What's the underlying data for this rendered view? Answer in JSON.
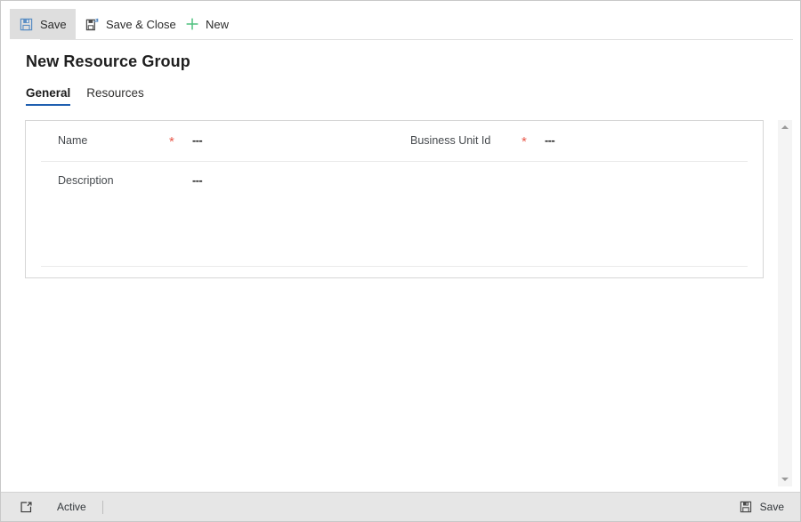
{
  "command_bar": {
    "buttons": [
      {
        "label": "Save",
        "icon": "floppy-disk-icon",
        "active": true
      },
      {
        "label": "Save & Close",
        "icon": "save-and-close-icon",
        "active": false
      },
      {
        "label": "New",
        "icon": "plus-icon",
        "active": false
      }
    ]
  },
  "page": {
    "title": "New Resource Group"
  },
  "tabs": [
    {
      "label": "General",
      "selected": true
    },
    {
      "label": "Resources",
      "selected": false
    }
  ],
  "form": {
    "fields": [
      {
        "label": "Name",
        "required": true,
        "required_mark": "*",
        "value": "---"
      },
      {
        "label": "Business Unit Id",
        "required": true,
        "required_mark": "*",
        "value": "---"
      },
      {
        "label": "Description",
        "required": false,
        "required_mark": "",
        "value": "---"
      }
    ]
  },
  "status_bar": {
    "popout_icon": "open-in-new-window-icon",
    "state": "Active",
    "save_label": "Save",
    "save_icon": "floppy-disk-icon"
  },
  "scrollbar": {
    "up_arrow_icon": "chevron-up-icon",
    "down_arrow_icon": "chevron-down-icon"
  },
  "colors": {
    "accent_blue": "#1f5fb0",
    "required_red": "#e8584a",
    "new_green": "#4ec17f",
    "icon_blue": "#5b8ec4",
    "status_bar_bg": "#e6e6e6",
    "active_cmd_bg": "#dedede"
  }
}
